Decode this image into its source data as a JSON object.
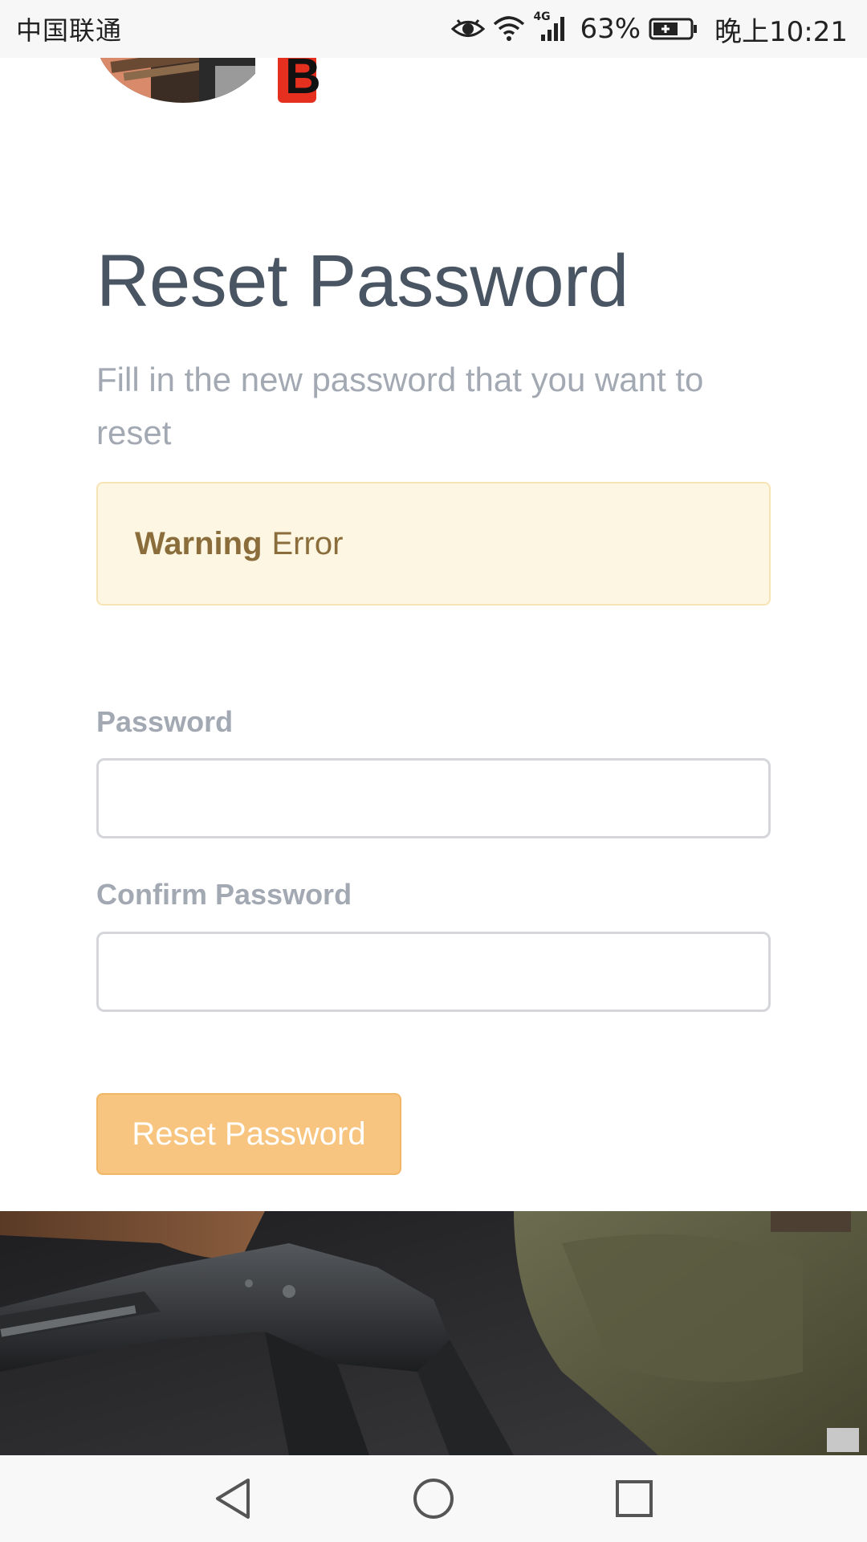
{
  "status_bar": {
    "carrier": "中国联通",
    "network": "4G",
    "battery_percent": "63%",
    "time": "晚上10:21",
    "icons": [
      "eye-icon",
      "wifi-icon",
      "signal-icon",
      "battery-icon"
    ]
  },
  "header": {
    "logo_letter": "B"
  },
  "page": {
    "title": "Reset Password",
    "subtitle": "Fill in the new password that you want to reset"
  },
  "alert": {
    "strong": "Warning",
    "message": "Error",
    "colors": {
      "background": "#fdf6e2",
      "border": "#f7e4b4",
      "text": "#8a6d3b"
    }
  },
  "form": {
    "password": {
      "label": "Password",
      "value": ""
    },
    "confirm_password": {
      "label": "Confirm Password",
      "value": ""
    },
    "submit_label": "Reset Password"
  },
  "theme": {
    "accent": "#f7c57f",
    "title_color": "#4a5563",
    "muted_text": "#a3a9b3"
  },
  "nav_bar": {
    "buttons": [
      "back-icon",
      "home-icon",
      "recents-icon"
    ]
  }
}
